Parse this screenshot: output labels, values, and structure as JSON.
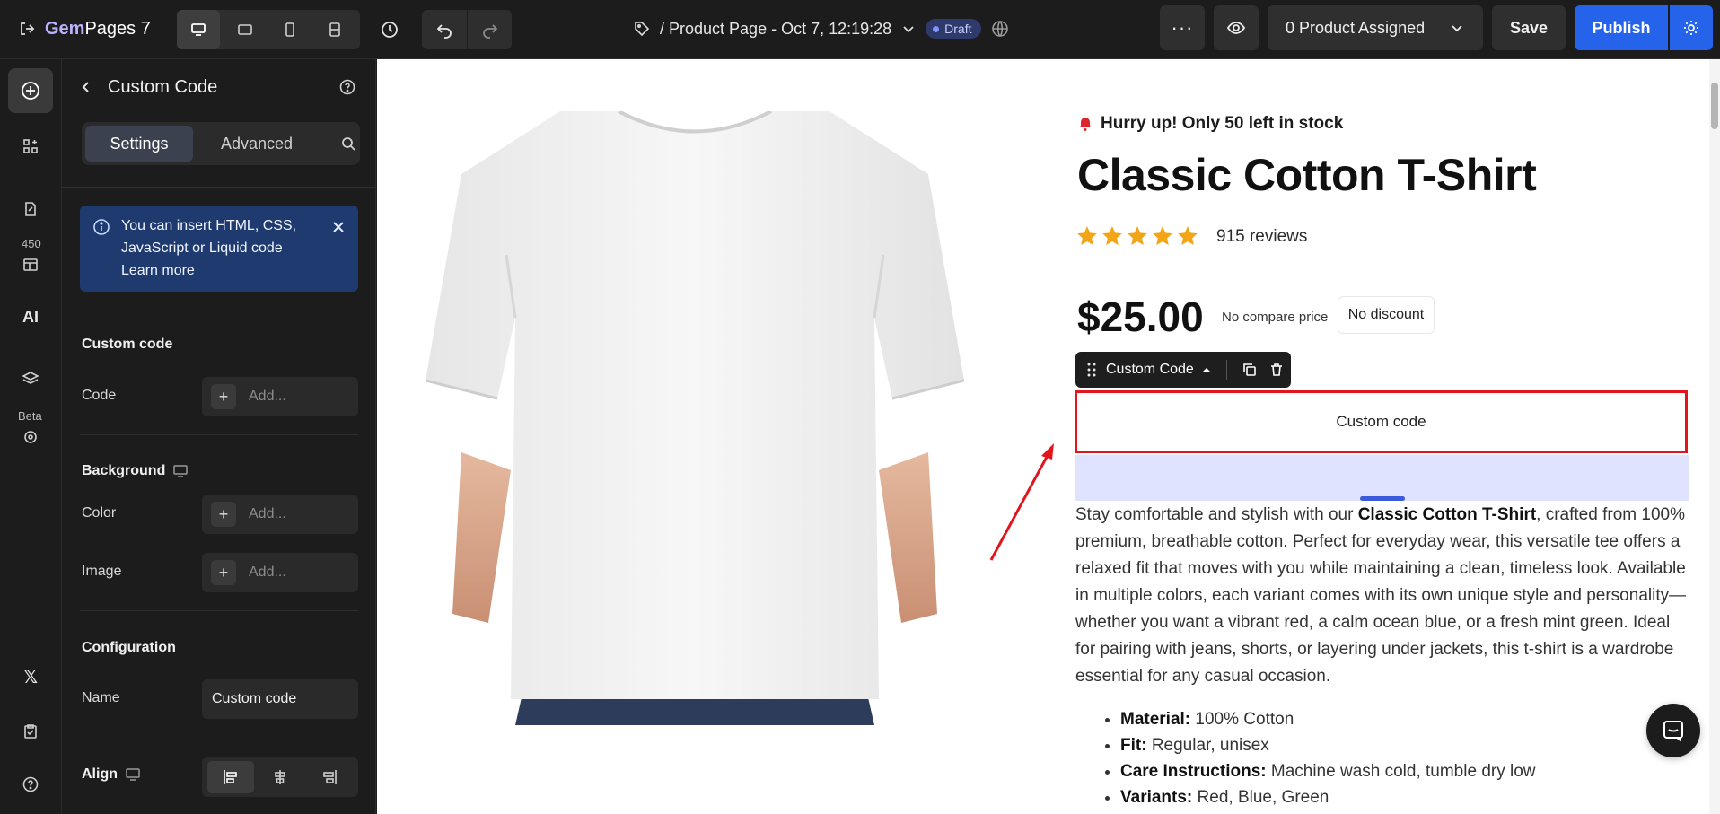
{
  "app": {
    "brand_prefix": "Gem",
    "brand_suffix": "Pages",
    "version": "7"
  },
  "topbar": {
    "page_title": "/ Product Page - Oct 7, 12:19:28",
    "status_badge": "Draft",
    "product_assigned": "0 Product Assigned",
    "save_label": "Save",
    "publish_label": "Publish",
    "brand_color": "#2563eb"
  },
  "rail": {
    "badge_count": "450",
    "beta_label": "Beta",
    "ai_label": "AI"
  },
  "panel": {
    "title": "Custom Code",
    "tabs": [
      "Settings",
      "Advanced"
    ],
    "info": {
      "text": "You can insert HTML, CSS, JavaScript or Liquid code",
      "link": "Learn more"
    },
    "sections": {
      "custom_code": "Custom code",
      "code_label": "Code",
      "background": "Background",
      "color_label": "Color",
      "image_label": "Image",
      "configuration": "Configuration",
      "name_label": "Name",
      "name_value": "Custom code",
      "align": "Align",
      "add_placeholder": "Add..."
    }
  },
  "product": {
    "stock_message": "Hurry up! Only 50 left in stock",
    "title": "Classic Cotton T-Shirt",
    "rating": 5,
    "reviews": "915 reviews",
    "price": "$25.00",
    "compare_price": "No compare price",
    "discount": "No discount",
    "custom_code_toolbar_label": "Custom Code",
    "custom_code_box": "Custom code",
    "description": {
      "part1": "Stay comfortable and stylish with our ",
      "bold": "Classic Cotton T-Shirt",
      "part2": ", crafted from 100% premium, breathable cotton. Perfect for everyday wear, this versatile tee offers a relaxed fit that moves with you while maintaining a clean, timeless look. Available in multiple colors, each variant comes with its own unique style and personality—whether you want a vibrant red, a calm ocean blue, or a fresh mint green. Ideal for pairing with jeans, shorts, or layering under jackets, this t-shirt is a wardrobe essential for any casual occasion."
    },
    "bullets": [
      {
        "key": "Material:",
        "value": " 100% Cotton"
      },
      {
        "key": "Fit:",
        "value": " Regular, unisex"
      },
      {
        "key": "Care Instructions:",
        "value": " Machine wash cold, tumble dry low"
      },
      {
        "key": "Variants:",
        "value": " Red, Blue, Green"
      }
    ],
    "selection_color": "#e3141b"
  }
}
